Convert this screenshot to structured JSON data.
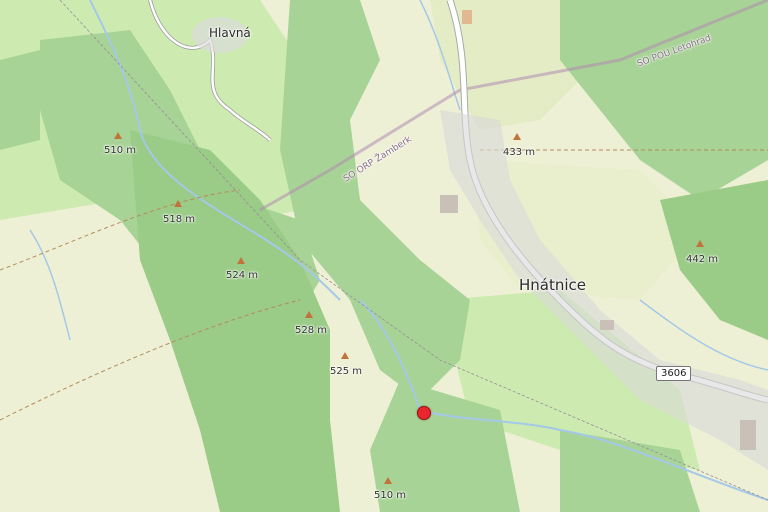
{
  "map": {
    "places": {
      "town": "Hnátnice",
      "village": "Hlavná"
    },
    "boundaries": {
      "orp": "SO ORP Žamberk",
      "pou": "SO POU Letohrad"
    },
    "route": "3606",
    "elevations": {
      "e1": "510 m",
      "e2": "518 m",
      "e3": "524 m",
      "e4": "528 m",
      "e5": "525 m",
      "e6": "510 m",
      "e7": "433 m",
      "e8": "442 m"
    },
    "colors": {
      "forest": "#a8d396",
      "forest_dense": "#8ec27e",
      "meadow": "#cdebb0",
      "farmland": "#eef0d5",
      "water": "#a4c8e8",
      "road": "#ffffff",
      "marker": "#e8262b"
    },
    "marker": "selected-location"
  }
}
